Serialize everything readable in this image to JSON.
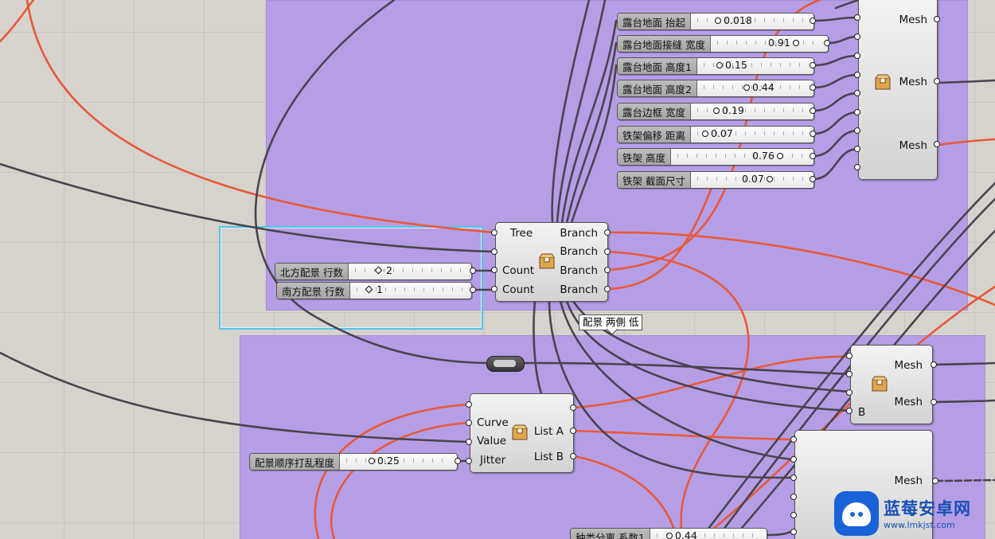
{
  "colors": {
    "group": "#b59ee6",
    "wire_dark": "#4a4450",
    "wire_orange": "#e8593a",
    "selection": "#57c3e6"
  },
  "sliders": {
    "s1": {
      "label": "露台地面 抬起",
      "value": "0.018"
    },
    "s2": {
      "label": "露台地面接缝 宽度",
      "value": "0.91"
    },
    "s3": {
      "label": "露台地面 高度1",
      "value": "0.15"
    },
    "s4": {
      "label": "露台地面 高度2",
      "value": "0.44"
    },
    "s5": {
      "label": "露台边框 宽度",
      "value": "0.19"
    },
    "s6": {
      "label": "铁架偏移 距离",
      "value": "0.07"
    },
    "s7": {
      "label": "铁架 高度",
      "value": "0.76"
    },
    "s8": {
      "label": "铁架 截面尺寸",
      "value": "0.07"
    },
    "north": {
      "label": "北方配景 行数",
      "value": "2"
    },
    "south": {
      "label": "南方配景 行数",
      "value": "1"
    },
    "jitter": {
      "label": "配景顺序打乱程度",
      "value": "0.25"
    },
    "bottom": {
      "label": "种类分离 系数1",
      "value": "0.44"
    }
  },
  "cluster_top": {
    "outputs": [
      "Mesh",
      "Mesh",
      "Mesh"
    ]
  },
  "cluster_branch": {
    "inputs": [
      "Tree",
      "",
      "Count",
      "Count"
    ],
    "outputs": [
      "Branch",
      "Branch",
      "Branch",
      "Branch"
    ],
    "tooltip": "配景 两側 低"
  },
  "cluster_jitter": {
    "inputs": [
      "Curve",
      "Value",
      "Jitter"
    ],
    "outputs": [
      "List A",
      "List B"
    ]
  },
  "cluster_mid": {
    "inputs": [
      "",
      "",
      "",
      "B"
    ],
    "outputs": [
      "Mesh",
      "Mesh"
    ]
  },
  "cluster_bottom": {
    "outputs": [
      "Mesh"
    ]
  },
  "watermark": {
    "title": "蓝莓安卓网",
    "url": "www.lmkjst.com"
  }
}
